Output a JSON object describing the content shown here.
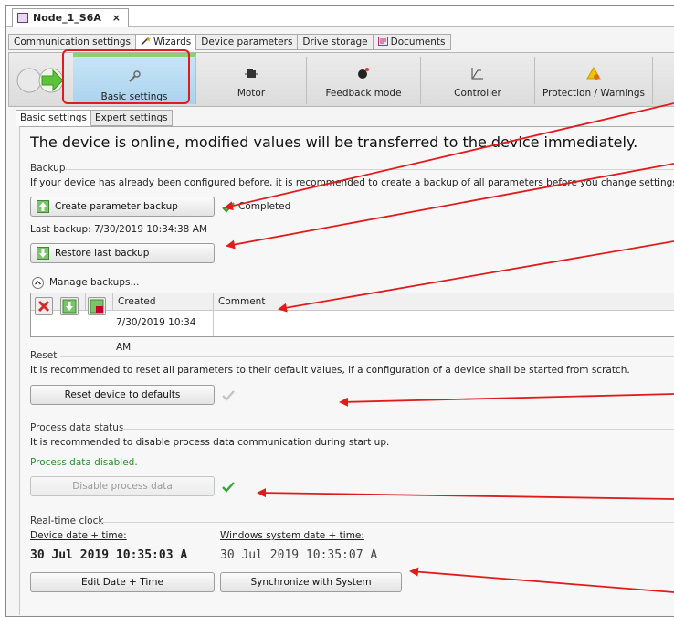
{
  "document_tab": {
    "title": "Node_1_S6A",
    "close": "×"
  },
  "top_tabs": [
    {
      "label": "Communication settings"
    },
    {
      "label": "Wizards"
    },
    {
      "label": "Device parameters"
    },
    {
      "label": "Drive storage"
    },
    {
      "label": "Documents"
    }
  ],
  "wizard_steps": [
    {
      "label": "Basic settings",
      "icon": "wrench-icon"
    },
    {
      "label": "Motor",
      "icon": "motor-icon"
    },
    {
      "label": "Feedback mode",
      "icon": "feedback-icon"
    },
    {
      "label": "Controller",
      "icon": "controller-icon"
    },
    {
      "label": "Protection / Warnings",
      "icon": "warning-icon"
    }
  ],
  "sub_tabs": [
    {
      "label": "Basic settings"
    },
    {
      "label": "Expert settings"
    }
  ],
  "online_message": "The device is online, modified  values will be transferred to the device immediately.",
  "backup": {
    "title": "Backup",
    "description": "If your device has already been configured before, it is recommended to create a backup of all parameters before you change settings.",
    "create_button": "Create parameter backup",
    "status": "Completed",
    "last_backup": "Last backup: 7/30/2019 10:34:38 AM",
    "restore_button": "Restore last backup",
    "manage_label": "Manage backups...",
    "table": {
      "headers": [
        "Created",
        "Comment"
      ],
      "rows": [
        {
          "created": "7/30/2019 10:34 AM",
          "comment": ""
        }
      ]
    }
  },
  "reset": {
    "title": "Reset",
    "description": "It is recommended to reset all parameters to their default values, if a configuration of a device shall be started from scratch.",
    "button": "Reset device to defaults"
  },
  "process_data": {
    "title": "Process data status",
    "description": "It is recommended to disable process data communication during start up.",
    "status": "Process data disabled.",
    "button": "Disable process data"
  },
  "rtc": {
    "title": "Real-time clock",
    "device_label": "Device date + time:",
    "windows_label": "Windows system date + time:",
    "device_value": "30 Jul 2019 10:35:03 A",
    "windows_value": "30 Jul 2019 10:35:07 A",
    "edit_button": "Edit Date + Time",
    "sync_button": "Synchronize with System"
  },
  "colors": {
    "accent_red": "#e01b1b",
    "active_tab": "#a9d3ee",
    "progress_green": "#86d46a",
    "check_green": "#3aa53a"
  }
}
